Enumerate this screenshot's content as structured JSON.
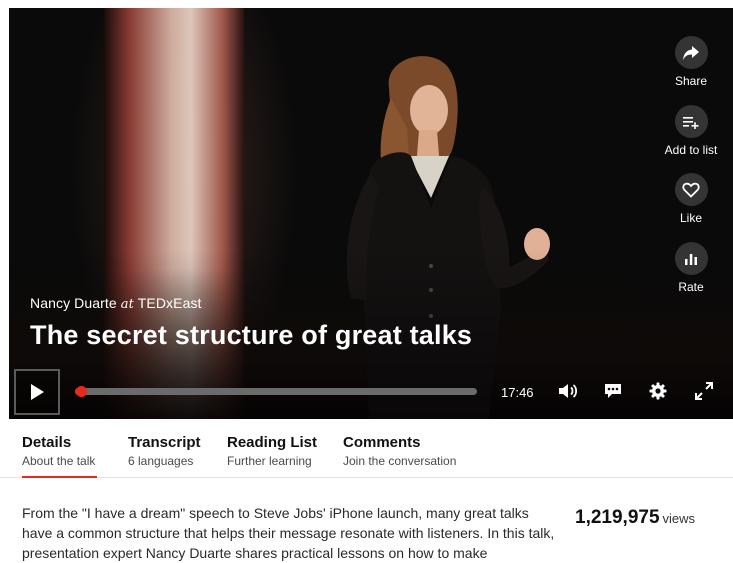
{
  "video": {
    "speaker": "Nancy Duarte",
    "at_word": "at",
    "event": "TEDxEast",
    "title": "The secret structure of great talks",
    "duration": "17:46",
    "progress_fraction": 0.0
  },
  "actions": [
    {
      "label": "Share",
      "icon": "share-icon"
    },
    {
      "label": "Add to list",
      "icon": "add-to-list-icon"
    },
    {
      "label": "Like",
      "icon": "heart-icon"
    },
    {
      "label": "Rate",
      "icon": "rate-icon"
    }
  ],
  "controls": {
    "play_icon": "play-icon",
    "volume_icon": "volume-icon",
    "captions_icon": "captions-icon",
    "settings_icon": "gear-icon",
    "fullscreen_icon": "fullscreen-icon"
  },
  "tabs": [
    {
      "title": "Details",
      "subtitle": "About the talk",
      "active": true
    },
    {
      "title": "Transcript",
      "subtitle": "6 languages",
      "active": false
    },
    {
      "title": "Reading List",
      "subtitle": "Further learning",
      "active": false
    },
    {
      "title": "Comments",
      "subtitle": "Join the conversation",
      "active": false
    }
  ],
  "details": {
    "description": "From the \"I have a dream\" speech to Steve Jobs' iPhone launch, many great talks have a common structure that helps their message resonate with listeners. In this talk, presentation expert Nancy Duarte shares practical lessons on how to make",
    "views_count": "1,219,975",
    "views_label": "views"
  },
  "colors": {
    "accent": "#e62b1e",
    "player_bg": "#0a0a0a",
    "text": "#111111"
  }
}
